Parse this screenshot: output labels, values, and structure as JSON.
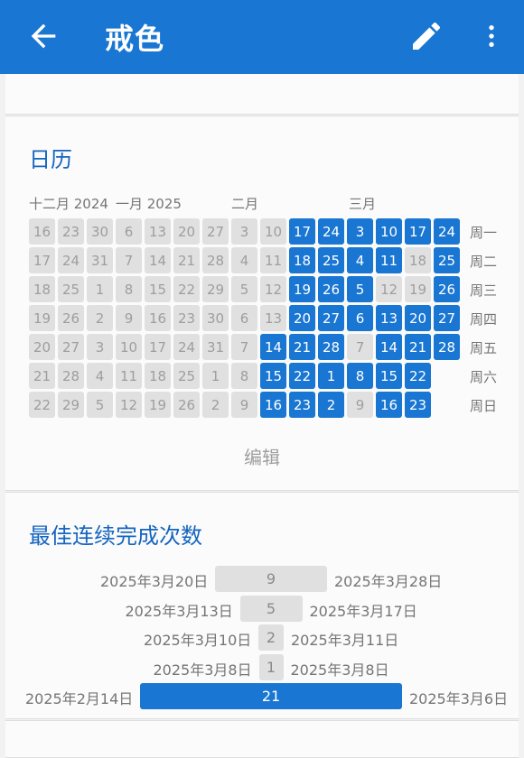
{
  "appbar": {
    "title": "戒色",
    "back_icon": "arrow-left-icon",
    "edit_icon": "pencil-icon",
    "more_icon": "more-vert-icon"
  },
  "calendar": {
    "title": "日历",
    "months": [
      "十二月 2024",
      "一月 2025",
      "二月",
      "三月"
    ],
    "weekdays": [
      "周一",
      "周二",
      "周三",
      "周四",
      "周五",
      "周六",
      "周日"
    ],
    "columns": [
      [
        {
          "d": "16",
          "s": 0
        },
        {
          "d": "17",
          "s": 0
        },
        {
          "d": "18",
          "s": 0
        },
        {
          "d": "19",
          "s": 0
        },
        {
          "d": "20",
          "s": 0
        },
        {
          "d": "21",
          "s": 0
        },
        {
          "d": "22",
          "s": 0
        }
      ],
      [
        {
          "d": "23",
          "s": 0
        },
        {
          "d": "24",
          "s": 0
        },
        {
          "d": "25",
          "s": 0
        },
        {
          "d": "26",
          "s": 0
        },
        {
          "d": "27",
          "s": 0
        },
        {
          "d": "28",
          "s": 0
        },
        {
          "d": "29",
          "s": 0
        }
      ],
      [
        {
          "d": "30",
          "s": 0
        },
        {
          "d": "31",
          "s": 0
        },
        {
          "d": "1",
          "s": 0
        },
        {
          "d": "2",
          "s": 0
        },
        {
          "d": "3",
          "s": 0
        },
        {
          "d": "4",
          "s": 0
        },
        {
          "d": "5",
          "s": 0
        }
      ],
      [
        {
          "d": "6",
          "s": 0
        },
        {
          "d": "7",
          "s": 0
        },
        {
          "d": "8",
          "s": 0
        },
        {
          "d": "9",
          "s": 0
        },
        {
          "d": "10",
          "s": 0
        },
        {
          "d": "11",
          "s": 0
        },
        {
          "d": "12",
          "s": 0
        }
      ],
      [
        {
          "d": "13",
          "s": 0
        },
        {
          "d": "14",
          "s": 0
        },
        {
          "d": "15",
          "s": 0
        },
        {
          "d": "16",
          "s": 0
        },
        {
          "d": "17",
          "s": 0
        },
        {
          "d": "18",
          "s": 0
        },
        {
          "d": "19",
          "s": 0
        }
      ],
      [
        {
          "d": "20",
          "s": 0
        },
        {
          "d": "21",
          "s": 0
        },
        {
          "d": "22",
          "s": 0
        },
        {
          "d": "23",
          "s": 0
        },
        {
          "d": "24",
          "s": 0
        },
        {
          "d": "25",
          "s": 0
        },
        {
          "d": "26",
          "s": 0
        }
      ],
      [
        {
          "d": "27",
          "s": 0
        },
        {
          "d": "28",
          "s": 0
        },
        {
          "d": "29",
          "s": 0
        },
        {
          "d": "30",
          "s": 0
        },
        {
          "d": "31",
          "s": 0
        },
        {
          "d": "1",
          "s": 0
        },
        {
          "d": "2",
          "s": 0
        }
      ],
      [
        {
          "d": "3",
          "s": 0
        },
        {
          "d": "4",
          "s": 0
        },
        {
          "d": "5",
          "s": 0
        },
        {
          "d": "6",
          "s": 0
        },
        {
          "d": "7",
          "s": 0
        },
        {
          "d": "8",
          "s": 0
        },
        {
          "d": "9",
          "s": 0
        }
      ],
      [
        {
          "d": "10",
          "s": 0
        },
        {
          "d": "11",
          "s": 0
        },
        {
          "d": "12",
          "s": 0
        },
        {
          "d": "13",
          "s": 0
        },
        {
          "d": "14",
          "s": 1
        },
        {
          "d": "15",
          "s": 1
        },
        {
          "d": "16",
          "s": 1
        }
      ],
      [
        {
          "d": "17",
          "s": 1
        },
        {
          "d": "18",
          "s": 1
        },
        {
          "d": "19",
          "s": 1
        },
        {
          "d": "20",
          "s": 1
        },
        {
          "d": "21",
          "s": 1
        },
        {
          "d": "22",
          "s": 1
        },
        {
          "d": "23",
          "s": 1
        }
      ],
      [
        {
          "d": "24",
          "s": 1
        },
        {
          "d": "25",
          "s": 1
        },
        {
          "d": "26",
          "s": 1
        },
        {
          "d": "27",
          "s": 1
        },
        {
          "d": "28",
          "s": 1
        },
        {
          "d": "1",
          "s": 1
        },
        {
          "d": "2",
          "s": 1
        }
      ],
      [
        {
          "d": "3",
          "s": 1
        },
        {
          "d": "4",
          "s": 1
        },
        {
          "d": "5",
          "s": 1
        },
        {
          "d": "6",
          "s": 1
        },
        {
          "d": "7",
          "s": 0
        },
        {
          "d": "8",
          "s": 1
        },
        {
          "d": "9",
          "s": 0
        }
      ],
      [
        {
          "d": "10",
          "s": 1
        },
        {
          "d": "11",
          "s": 1
        },
        {
          "d": "12",
          "s": 0
        },
        {
          "d": "13",
          "s": 1
        },
        {
          "d": "14",
          "s": 1
        },
        {
          "d": "15",
          "s": 1
        },
        {
          "d": "16",
          "s": 1
        }
      ],
      [
        {
          "d": "17",
          "s": 1
        },
        {
          "d": "18",
          "s": 0
        },
        {
          "d": "19",
          "s": 0
        },
        {
          "d": "20",
          "s": 1
        },
        {
          "d": "21",
          "s": 1
        },
        {
          "d": "22",
          "s": 1
        },
        {
          "d": "23",
          "s": 1
        }
      ],
      [
        {
          "d": "24",
          "s": 1
        },
        {
          "d": "25",
          "s": 1
        },
        {
          "d": "26",
          "s": 1
        },
        {
          "d": "27",
          "s": 1
        },
        {
          "d": "28",
          "s": 1
        },
        {
          "d": "",
          "s": -1
        },
        {
          "d": "",
          "s": -1
        }
      ]
    ],
    "edit_label": "编辑"
  },
  "streaks": {
    "title": "最佳连续完成次数",
    "max_length": 21,
    "items": [
      {
        "start": "2025年3月20日",
        "end": "2025年3月28日",
        "length": 9,
        "label": "9",
        "current": false
      },
      {
        "start": "2025年3月13日",
        "end": "2025年3月17日",
        "length": 5,
        "label": "5",
        "current": false
      },
      {
        "start": "2025年3月10日",
        "end": "2025年3月11日",
        "length": 2,
        "label": "2",
        "current": false
      },
      {
        "start": "2025年3月8日",
        "end": "2025年3月8日",
        "length": 1,
        "label": "1",
        "current": false
      },
      {
        "start": "2025年2月14日",
        "end": "2025年3月6日",
        "length": 21,
        "label": "21",
        "current": true
      }
    ]
  },
  "colors": {
    "accent": "#1976d2",
    "off": "#e0e0e0",
    "title": "#1565c0"
  }
}
